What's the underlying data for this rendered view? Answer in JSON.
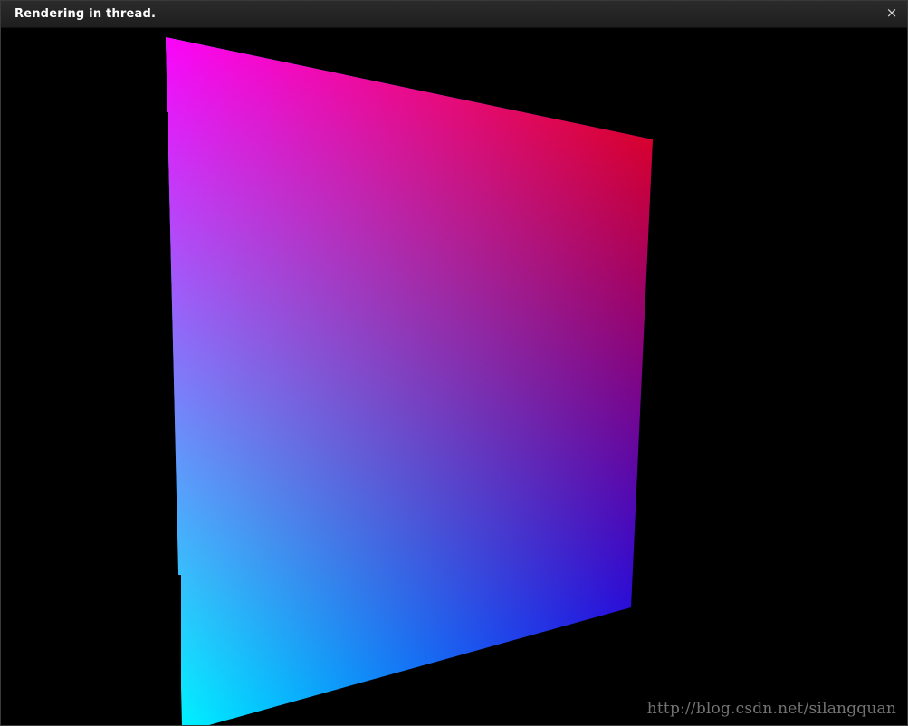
{
  "window": {
    "title": "Rendering in thread.",
    "close_glyph": "×",
    "close_icon": "close-icon"
  },
  "render": {
    "vertex_colors": {
      "top_left": "#ff00ff",
      "top_right": "#ff0000",
      "bottom_right": "#0000ff",
      "bottom_left": "#00ffff"
    },
    "background": "#000000"
  },
  "watermark": {
    "text": "http://blog.csdn.net/silangquan"
  }
}
